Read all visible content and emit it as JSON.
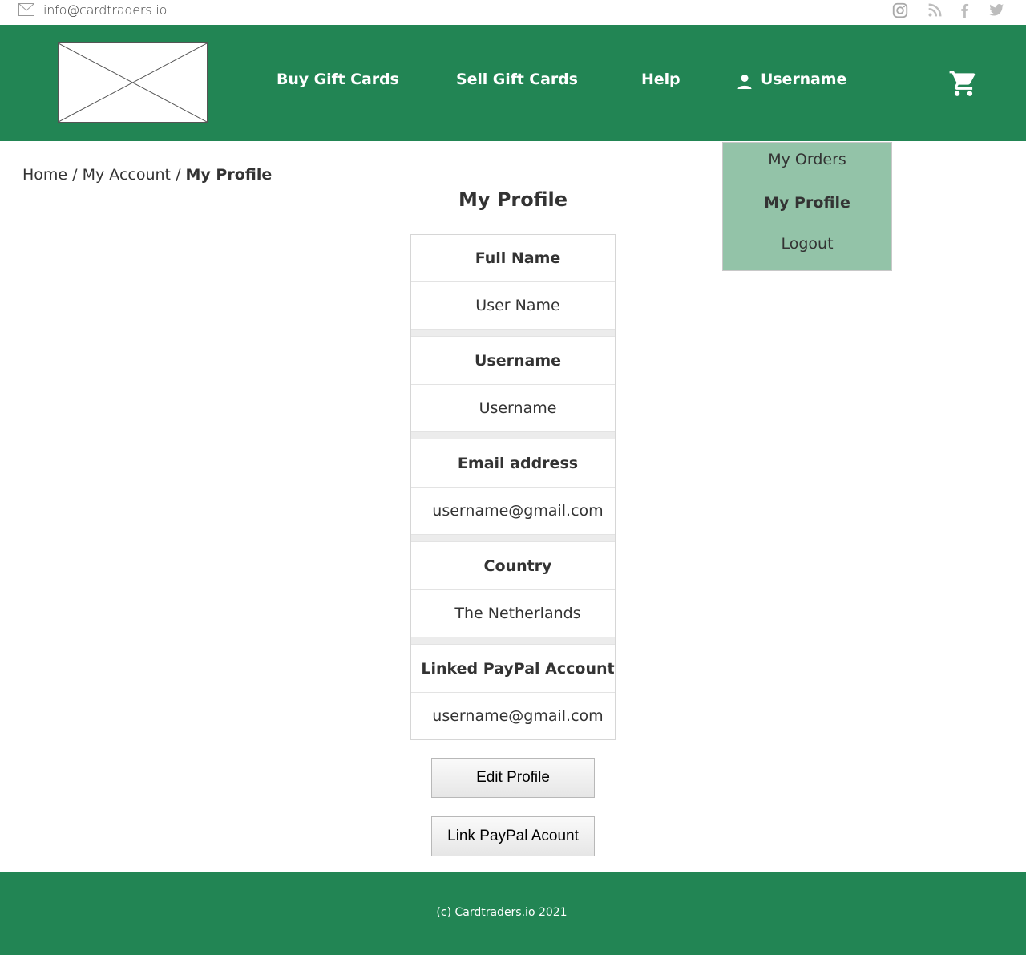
{
  "topbar": {
    "email": "info@cardtraders.io",
    "icons": [
      "mail-icon",
      "instagram-icon",
      "rss-icon",
      "facebook-icon",
      "twitter-icon"
    ]
  },
  "header": {
    "nav": {
      "buy": "Buy Gift Cards",
      "sell": "Sell Gift Cards",
      "help": "Help",
      "username": "Username"
    },
    "icons": [
      "logo-placeholder",
      "user-icon",
      "cart-icon"
    ],
    "background_color": "#228554"
  },
  "dropdown": {
    "items": [
      {
        "label": "My Orders"
      },
      {
        "label": "My Profile"
      },
      {
        "label": "Logout"
      }
    ],
    "background_color": "#93c3a8"
  },
  "breadcrumb": {
    "items": [
      "Home",
      "My Account"
    ],
    "separator": "/",
    "current": "My Profile"
  },
  "main": {
    "title": "My Profile",
    "fields": [
      {
        "label": "Full Name",
        "value": "User Name"
      },
      {
        "label": "Username",
        "value": "Username"
      },
      {
        "label": "Email address",
        "value": "username@gmail.com"
      },
      {
        "label": "Country",
        "value": "The Netherlands"
      },
      {
        "label": "Linked PayPal Account",
        "value": "username@gmail.com"
      }
    ],
    "buttons": {
      "edit": "Edit Profile",
      "link_paypal": "Link PayPal Acount"
    }
  },
  "footer": {
    "copyright": "(c) Cardtraders.io 2021",
    "background_color": "#228554"
  }
}
